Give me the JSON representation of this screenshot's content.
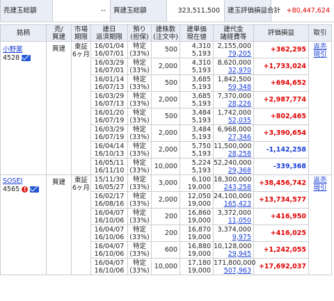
{
  "summary": {
    "sell_label": "売建玉総額",
    "sell_value": "--",
    "buy_label": "買建玉総額",
    "buy_value": "323,511,500",
    "pl_label": "建玉評価損益合計",
    "pl_value": "+80,447,624"
  },
  "headers": {
    "stock": "銘柄",
    "type": "売/\n買建",
    "market": "市場\n期限",
    "date": "建日\n返済期限",
    "deposit": "預り\n(担保)",
    "qty": "建株数\n(注文中)",
    "price": "建単価\n現在値",
    "amount": "建代金\n諸経費等",
    "pl": "評価損益",
    "action": "取引"
  },
  "stocks": [
    {
      "name": "小野薬",
      "code": "4528",
      "type": "買建",
      "market": "東証",
      "term": "6ヶ月",
      "action1": "返売",
      "action2": "現引",
      "has_alert": false,
      "rows": [
        {
          "open": "16/01/04",
          "due": "16/07/01",
          "deposit": "特定",
          "margin": "(33%)",
          "qty": "500",
          "price": "4,310",
          "now": "5,193",
          "amount": "2,155,000",
          "fee": "79,205",
          "pl": "+362,295"
        },
        {
          "open": "16/03/29",
          "due": "16/07/01",
          "deposit": "特定",
          "margin": "(33%)",
          "qty": "2,000",
          "price": "4,310",
          "now": "5,193",
          "amount": "8,620,000",
          "fee": "32,970",
          "pl": "+1,733,024"
        },
        {
          "open": "16/01/14",
          "due": "16/07/13",
          "deposit": "特定",
          "margin": "(33%)",
          "qty": "500",
          "price": "3,685",
          "now": "5,193",
          "amount": "1,842,500",
          "fee": "59,348",
          "pl": "+694,652"
        },
        {
          "open": "16/03/29",
          "due": "16/07/13",
          "deposit": "特定",
          "margin": "(33%)",
          "qty": "2,000",
          "price": "3,685",
          "now": "5,193",
          "amount": "7,370,000",
          "fee": "28,226",
          "pl": "+2,987,774"
        },
        {
          "open": "16/01/20",
          "due": "16/07/19",
          "deposit": "特定",
          "margin": "(33%)",
          "qty": "500",
          "price": "3,484",
          "now": "5,193",
          "amount": "1,742,000",
          "fee": "52,035",
          "pl": "+802,465"
        },
        {
          "open": "16/03/29",
          "due": "16/07/19",
          "deposit": "特定",
          "margin": "(33%)",
          "qty": "2,000",
          "price": "3,484",
          "now": "5,193",
          "amount": "6,968,000",
          "fee": "27,346",
          "pl": "+3,390,654"
        },
        {
          "open": "16/04/14",
          "due": "16/10/13",
          "deposit": "特定",
          "margin": "(33%)",
          "qty": "2,000",
          "price": "5,750",
          "now": "5,193",
          "amount": "11,500,000",
          "fee": "28,258",
          "pl": "-1,142,258"
        },
        {
          "open": "16/05/11",
          "due": "16/11/10",
          "deposit": "特定",
          "margin": "(33%)",
          "qty": "10,000",
          "price": "5,224",
          "now": "5,193",
          "amount": "52,240,000",
          "fee": "29,368",
          "pl": "-339,368"
        }
      ]
    },
    {
      "name": "SOSEI",
      "code": "4565",
      "type": "買建",
      "market": "東証",
      "term": "6ヶ月",
      "action1": "返売",
      "action2": "現引",
      "has_alert": true,
      "rows": [
        {
          "open": "15/11/30",
          "due": "16/05/27",
          "deposit": "特定",
          "margin": "(33%)",
          "qty": "3,000",
          "price": "6,100",
          "now": "19,000",
          "amount": "18,300,000",
          "fee": "243,258",
          "pl": "+38,456,742"
        },
        {
          "open": "16/02/17",
          "due": "16/08/16",
          "deposit": "特定",
          "margin": "(33%)",
          "qty": "2,000",
          "price": "12,050",
          "now": "19,000",
          "amount": "24,100,000",
          "fee": "165,423",
          "pl": "+13,734,577"
        },
        {
          "open": "16/04/07",
          "due": "16/10/06",
          "deposit": "特定",
          "margin": "(33%)",
          "qty": "200",
          "price": "16,860",
          "now": "19,000",
          "amount": "3,372,000",
          "fee": "11,050",
          "pl": "+416,950"
        },
        {
          "open": "16/04/07",
          "due": "16/10/06",
          "deposit": "特定",
          "margin": "(33%)",
          "qty": "200",
          "price": "16,870",
          "now": "19,000",
          "amount": "3,374,000",
          "fee": "9,975",
          "pl": "+416,025"
        },
        {
          "open": "16/04/07",
          "due": "16/10/06",
          "deposit": "特定",
          "margin": "(33%)",
          "qty": "600",
          "price": "16,880",
          "now": "19,000",
          "amount": "10,128,000",
          "fee": "29,945",
          "pl": "+1,242,055"
        },
        {
          "open": "16/04/07",
          "due": "16/10/06",
          "deposit": "特定",
          "margin": "(33%)",
          "qty": "10,000",
          "price": "17,180",
          "now": "19,000",
          "amount": "171,800,000",
          "fee": "507,963",
          "pl": "+17,692,037"
        }
      ]
    }
  ],
  "colors": {
    "header_bg": "#e9edf5",
    "border": "#c8ccd2",
    "positive": "#e00000",
    "negative": "#1a3fd6",
    "link": "#1a3fd6"
  },
  "icons": [
    "mail-icon",
    "alert-icon"
  ]
}
